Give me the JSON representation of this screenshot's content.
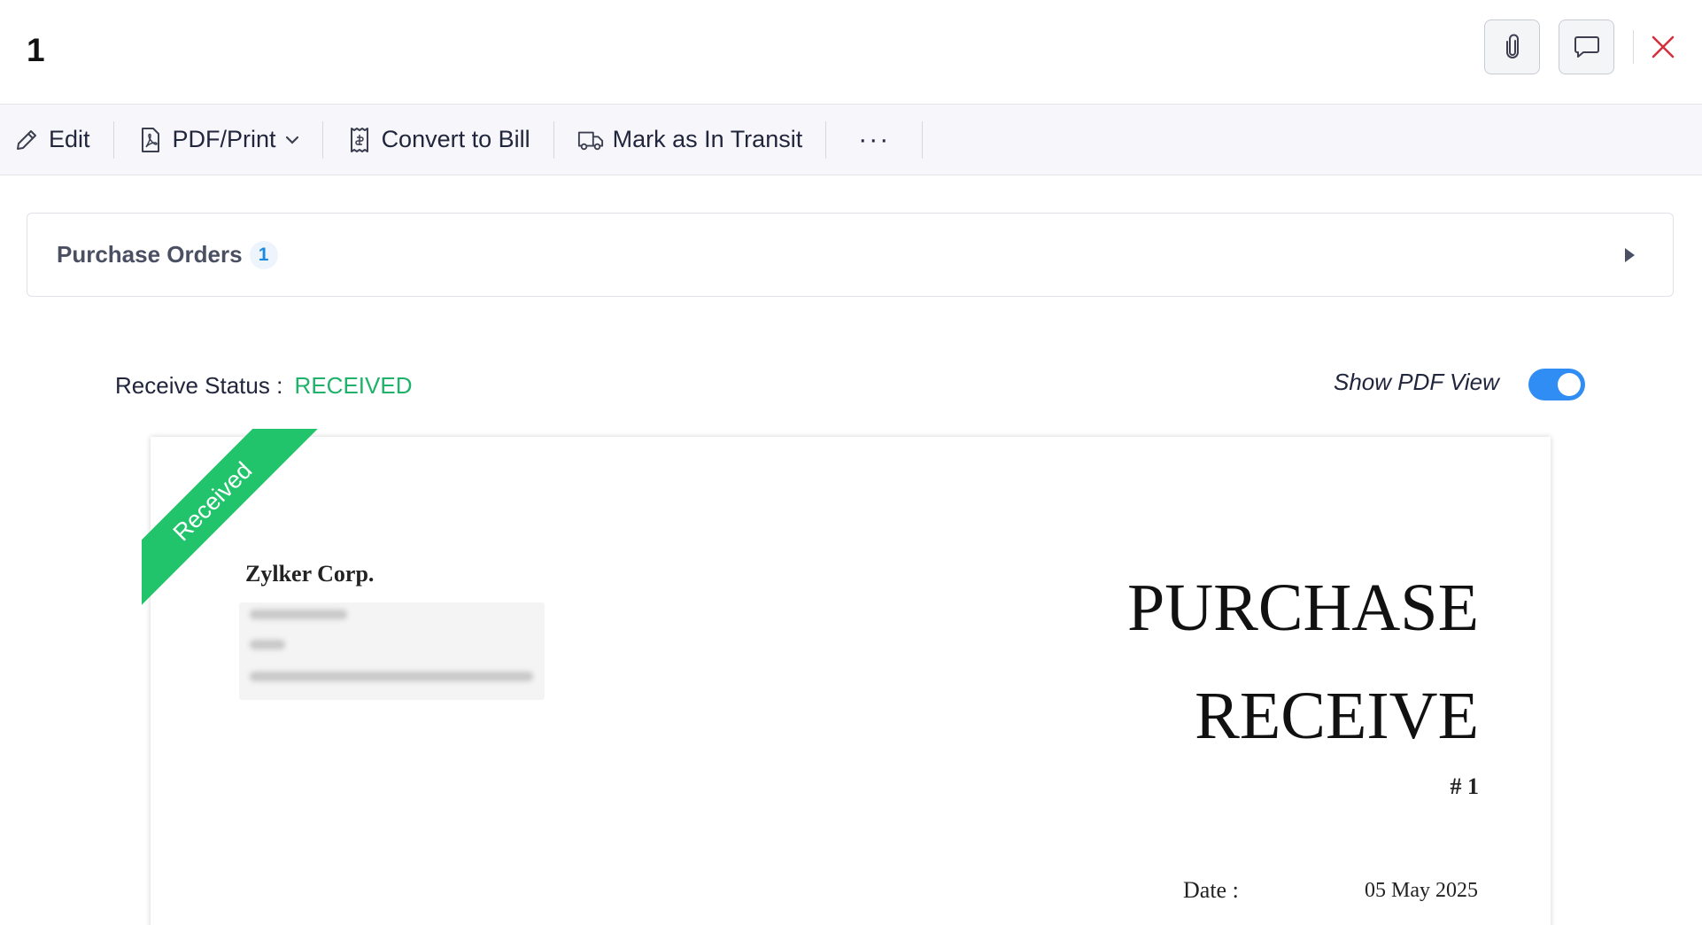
{
  "header": {
    "title": "1"
  },
  "toolbar": {
    "edit_label": "Edit",
    "pdf_print_label": "PDF/Print",
    "convert_to_bill_label": "Convert to Bill",
    "mark_in_transit_label": "Mark as In Transit",
    "more_label": "···"
  },
  "purchase_orders": {
    "label": "Purchase Orders",
    "count": "1"
  },
  "status": {
    "label": "Receive Status :",
    "value": "RECEIVED",
    "value_color": "#1fb26a"
  },
  "pdf_view": {
    "label": "Show PDF View",
    "enabled": true,
    "toggle_color": "#2f8df4"
  },
  "document": {
    "ribbon": "Received",
    "ribbon_color": "#21c46b",
    "company_name": "Zylker Corp.",
    "title_line1": "PURCHASE",
    "title_line2": "RECEIVE",
    "number": "# 1",
    "date_label": "Date :",
    "date_value": "05 May 2025"
  },
  "icons": {
    "attach": "paperclip-icon",
    "comment": "comment-icon",
    "close": "close-icon",
    "edit": "pencil-icon",
    "pdf": "pdf-file-icon",
    "convert": "receipt-icon",
    "transit": "truck-icon",
    "expand": "triangle-right-icon"
  }
}
